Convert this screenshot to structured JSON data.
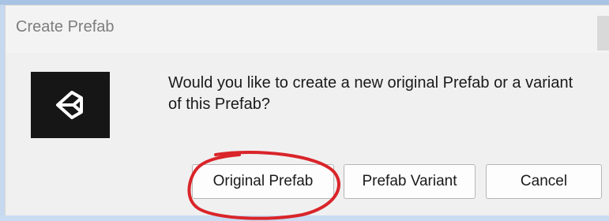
{
  "dialog": {
    "title": "Create Prefab",
    "message": "Would you like to create a new original Prefab or a variant of this Prefab?",
    "icon": "unity-logo-icon",
    "buttons": {
      "original": "Original Prefab",
      "variant": "Prefab Variant",
      "cancel": "Cancel"
    }
  },
  "colors": {
    "annotation": "#d9252a",
    "logo_background": "#161616",
    "dialog_background": "#f0f0f0"
  }
}
